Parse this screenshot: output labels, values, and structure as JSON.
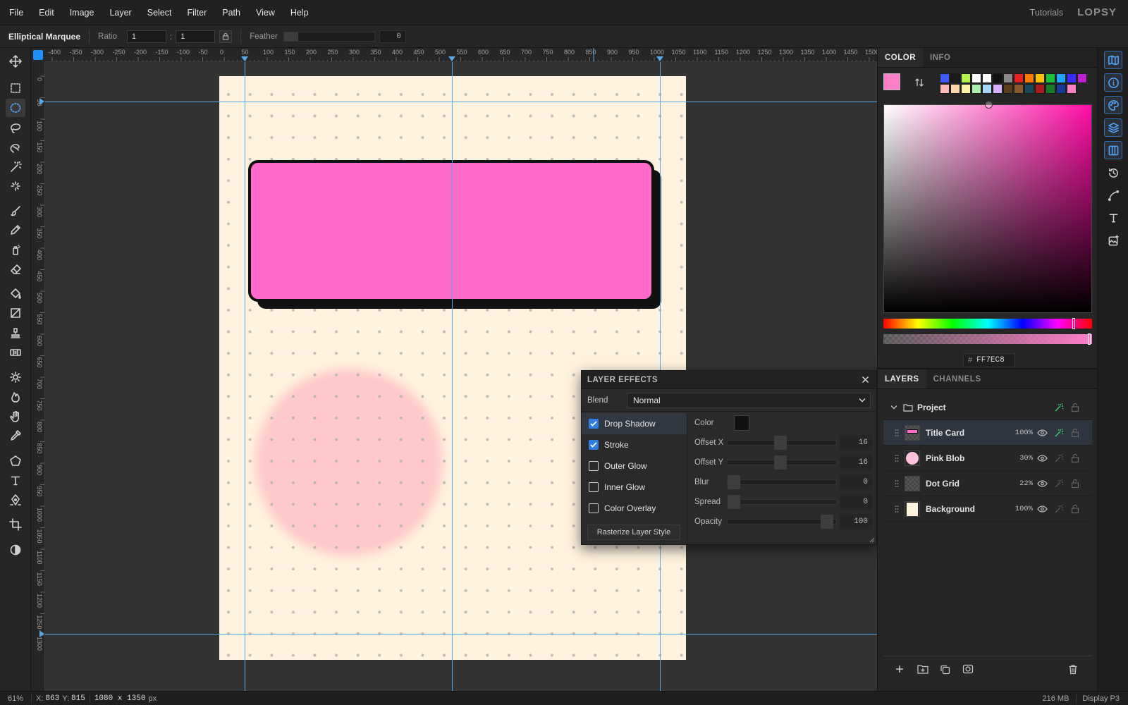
{
  "menu": [
    "File",
    "Edit",
    "Image",
    "Layer",
    "Select",
    "Filter",
    "Path",
    "View",
    "Help"
  ],
  "menu_right": {
    "tutorials": "Tutorials",
    "logo": "LOPSY"
  },
  "options": {
    "tool_name": "Elliptical Marquee",
    "ratio_label": "Ratio",
    "ratio_w": "1",
    "ratio_sep": ":",
    "ratio_h": "1",
    "feather_label": "Feather",
    "feather_value": "0"
  },
  "tools": [
    "move-icon",
    "rect-select-icon",
    "ellipse-select-icon",
    "lasso-icon",
    "poly-lasso-icon",
    "magic-wand-icon",
    "quick-select-icon",
    "brush-icon",
    "pencil-icon",
    "spray-icon",
    "eraser-icon",
    "bucket-icon",
    "gradient-icon",
    "stamp-icon",
    "patch-icon",
    "dodge-icon",
    "burn-icon",
    "smudge-icon",
    "eyedropper-icon",
    "shape-icon",
    "text-icon",
    "pen-icon",
    "crop-icon",
    "contrast-icon"
  ],
  "active_tool": "ellipse-select-icon",
  "ruler": {
    "h_ticks": [
      "-400",
      "-350",
      "-300",
      "-250",
      "-200",
      "-150",
      "-100",
      "-50",
      "0",
      "50",
      "100",
      "150",
      "200",
      "250",
      "300",
      "350",
      "400",
      "450",
      "500",
      "550",
      "600",
      "650",
      "700",
      "750",
      "800",
      "850",
      "900",
      "950",
      "1000",
      "1050",
      "1100",
      "1150",
      "1200",
      "1250",
      "1300",
      "1350",
      "1400",
      "1450",
      "1500"
    ],
    "v_ticks": [
      "0",
      "50",
      "100",
      "150",
      "200",
      "250",
      "300",
      "350",
      "400",
      "450",
      "500",
      "550",
      "600",
      "650",
      "700",
      "750",
      "800",
      "850",
      "900",
      "950",
      "1000",
      "1050",
      "1100",
      "1150",
      "1200",
      "1250",
      "1300"
    ]
  },
  "document": {
    "background_color": "#FFF2DE",
    "card_color": "#FF6ACB",
    "blob_color": "#FFC9C9",
    "dot_color": "#AAAAAA"
  },
  "color_panel": {
    "tabs": [
      "COLOR",
      "INFO"
    ],
    "fg_color": "#FF7EC8",
    "bg_color": "#FFFFFF",
    "swatches_row1": [
      "#3d5bff",
      "#1a1a1a",
      "#b7f24a",
      "#ffffff",
      "#fafafa",
      "#111111",
      "#888888",
      "#e82020",
      "#ff7a00",
      "#ffc000",
      "#19c23a",
      "#1ea5ff",
      "#3a2bff",
      "#c020d0"
    ],
    "swatches_row2": [
      "#ffb8b8",
      "#ffd6a8",
      "#fff2a8",
      "#a8f0b0",
      "#a8d8ff",
      "#d8b0ff",
      "#5a3d1a",
      "#8a5a2a",
      "#1a4a5a",
      "#aa1a1a",
      "#1a7a2a",
      "#1a3a9a",
      "#ff80c0"
    ],
    "hex_prefix": "#",
    "hex": "FF7EC8"
  },
  "layers_panel": {
    "tabs": [
      "LAYERS",
      "CHANNELS"
    ],
    "group": "Project",
    "layers": [
      {
        "name": "Title Card",
        "opacity": "100%"
      },
      {
        "name": "Pink Blob",
        "opacity": "30%"
      },
      {
        "name": "Dot Grid",
        "opacity": "22%"
      },
      {
        "name": "Background",
        "opacity": "100%"
      }
    ]
  },
  "effects": {
    "title": "LAYER EFFECTS",
    "blend_label": "Blend",
    "blend_value": "Normal",
    "items": [
      {
        "label": "Drop Shadow",
        "checked": true
      },
      {
        "label": "Stroke",
        "checked": true
      },
      {
        "label": "Outer Glow",
        "checked": false
      },
      {
        "label": "Inner Glow",
        "checked": false
      },
      {
        "label": "Color Overlay",
        "checked": false
      }
    ],
    "rasterize": "Rasterize Layer Style",
    "params": [
      {
        "label": "Color"
      },
      {
        "label": "Offset X",
        "value": "16",
        "level": 0.5
      },
      {
        "label": "Offset Y",
        "value": "16",
        "level": 0.5
      },
      {
        "label": "Blur",
        "value": "0",
        "level": 0
      },
      {
        "label": "Spread",
        "value": "0",
        "level": 0
      },
      {
        "label": "Opacity",
        "value": "100",
        "level": 1
      }
    ],
    "shadow_color": "#111111"
  },
  "status": {
    "zoom": "61%",
    "coords_x_label": "X:",
    "coords_x": "863",
    "coords_y_label": "Y:",
    "coords_y": "815",
    "doc_size": "1080 x 1350",
    "doc_unit": "px",
    "memory": "216 MB",
    "display": "Display P3"
  }
}
